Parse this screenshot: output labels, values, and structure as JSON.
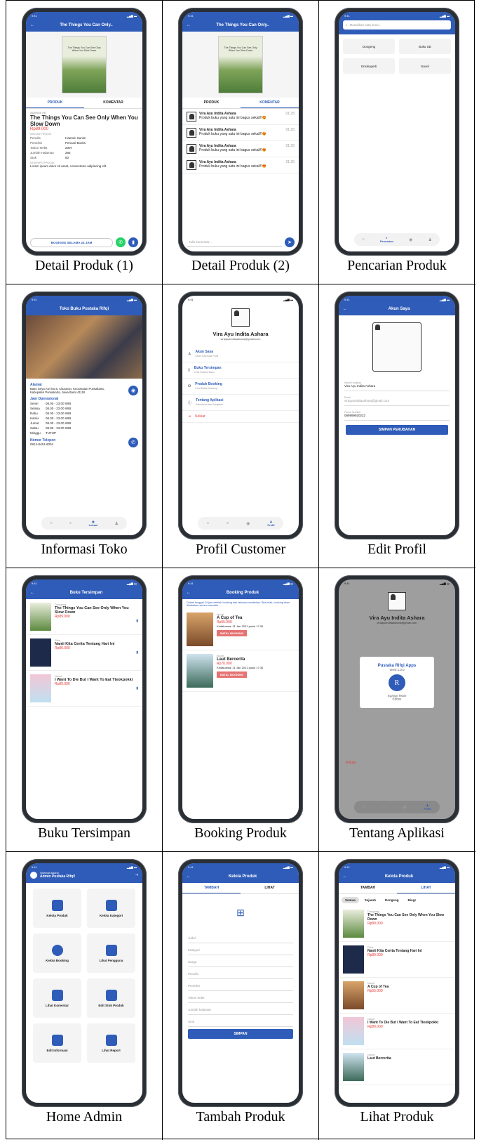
{
  "captions": [
    "Detail Produk (1)",
    "Detail Produk (2)",
    "Pencarian Produk",
    "Informasi Toko",
    "Profil Customer",
    "Edit Profil",
    "Buku Tersimpan",
    "Booking Produk",
    "Tentang Aplikasi",
    "Home Admin",
    "Tambah Produk",
    "Lihat Produk"
  ],
  "status_time": "9:41",
  "colors": {
    "primary": "#2f5cb8",
    "danger": "#e53935",
    "whatsapp": "#25d366"
  },
  "book_title_short": "The Things You Can Only..",
  "tabs": {
    "produk": "PRODUK",
    "komentar": "KOMENTAR",
    "tambah": "TAMBAH",
    "lihat": "LIHAT"
  },
  "detail": {
    "category": "Science Art",
    "title": "The Things You Can See Only When You Slow Down",
    "price": "Rp89.000",
    "info_head": "RINCIAN PRODUK",
    "rows": [
      {
        "k": "Penulis",
        "v": "Haemin Sunim"
      },
      {
        "k": "Penerbit",
        "v": "Pencari Books"
      },
      {
        "k": "Tahun Terbit",
        "v": "2007"
      },
      {
        "k": "Jumlah Halaman",
        "v": "265"
      },
      {
        "k": "Stok",
        "v": "50"
      }
    ],
    "desc_head": "DESKRIPSI PRODUK",
    "desc": "Lorem ipsum dolor sit amet, consectetur adipiscing elit.",
    "book_btn": "BOOKING SELAMA 24 JAM"
  },
  "comments": {
    "name": "Vira Ayu Indita Ashara",
    "time": "01:25",
    "items": [
      "Produk buku yang satu ini bagus sekali!!😍",
      "Produk buku yang satu ini bagus sekali!!😍",
      "Produk buku yang satu ini bagus sekali!!😍",
      "Produk buku yang satu ini bagus sekali!!😍"
    ],
    "placeholder": "Tulis komentar..."
  },
  "search": {
    "placeholder": "Masukkan kata kunci..",
    "chips": [
      "Dongeng",
      "Buku SD",
      "Enskiopedi",
      "Novel"
    ],
    "nav_label": "Pencarian"
  },
  "toko": {
    "title": "Toko Buku Pustaka Rifqi",
    "alamat_h": "Alamat",
    "alamat": "Baso Griya Asri No.6, Cisaueun, Kecamatan Purwakarta, Kabupaten Purwakarta, Jawa Barat 41118",
    "jam_h": "Jam Operasional",
    "jam": [
      {
        "d": "Senin",
        "t": "08.00 - 23.00 WIB"
      },
      {
        "d": "Selasa",
        "t": "08.00 - 23.00 WIB"
      },
      {
        "d": "Rabu",
        "t": "08.00 - 23.00 WIB"
      },
      {
        "d": "Kamis",
        "t": "08.00 - 23.00 WIB"
      },
      {
        "d": "Jumat",
        "t": "08.00 - 23.00 WIB"
      },
      {
        "d": "Sabtu",
        "t": "08.00 - 23.00 WIB"
      },
      {
        "d": "Minggu",
        "t": "TUTUP"
      }
    ],
    "telp_h": "Nomor Telepon",
    "telp": "0812-8451-6004",
    "nav_label": "Lokasi"
  },
  "profil": {
    "name": "Vira Ayu Indita Ashara",
    "email": "viraayuinditaashara@gmail.com",
    "menu": [
      {
        "t": "Akun Saya",
        "s": "Ubah Informasi Profil"
      },
      {
        "t": "Buku Tersimpan",
        "s": "Lihat Koleksi Buku"
      },
      {
        "t": "Produk Booking",
        "s": "Lihat Daftar Booking"
      },
      {
        "t": "Tentang Aplikasi",
        "s": "Ketentuan dan Kebijakan"
      }
    ],
    "logout": "Keluar",
    "nav_label": "Profil"
  },
  "edit": {
    "title": "Akun Saya",
    "f1l": "Nama Lengkap",
    "f1v": "Vira Ayu Indita Ashara",
    "f2l": "Email",
    "f2v": "viraayuinditaashara@gmail.com",
    "f3l": "Phone Number",
    "f3v": "089999920222",
    "btn": "SIMPAN PERUBAHAN"
  },
  "saved": {
    "title": "Buku Tersimpan",
    "items": [
      {
        "c": "Dongeng",
        "t": "The Things You Can See Only When You Slow Down",
        "p": "Rp89.000"
      },
      {
        "c": "Fiksi",
        "t": "Nanti Kita Cerita Tentang Hari Ini",
        "p": "Rp80.000"
      },
      {
        "c": "Novel",
        "t": "I Want To Die But I Want To Eat Tteokpokki",
        "p": "Rp89.000"
      }
    ]
  },
  "booking": {
    "title": "Booking Produk",
    "note": "Dalam tenggat 24 jam setelah booking dan lakukan pembelian. Bila tidak, booking akan dibatalkan secara otomatis.",
    "items": [
      {
        "c": "Novel",
        "t": "A Cup of Tea",
        "p": "Rp55.000",
        "d": "Kedaluarsa: 21 Jan 2021 pukul 17:30"
      },
      {
        "c": "Novel",
        "t": "Laut Bercerita",
        "p": "Rp70.000",
        "d": "Kedaluarsa: 21 Jan 2021 pukul 17:30"
      }
    ],
    "cancel": "BATAL BOOKING"
  },
  "about": {
    "app": "Pustaka Rifqi Apps",
    "ver": "Versi 1.0.0",
    "team": "Syzygy Team",
    "year": "©2021"
  },
  "admin": {
    "greet": "Selamat datang,",
    "name": "Admin Pustaka Rifqi!",
    "cards": [
      "Kelola Produk",
      "Kelola Kategori",
      "Kelola Booking",
      "Lihat Pengguna",
      "Lihat Komentar",
      "Edit Stok Produk",
      "Edit Informasi",
      "Lihat Report"
    ]
  },
  "tambah": {
    "title": "Kelola Produk",
    "fields": [
      "Judul",
      "Kategori",
      "Harga",
      "Penulis",
      "Penerbit",
      "Tahun terbit",
      "Jumlah halaman",
      "Stok"
    ],
    "btn": "SIMPAN"
  },
  "lihat": {
    "title": "Kelola Produk",
    "filters": [
      "Semua",
      "Sejarah",
      "Dongeng",
      "Biogr"
    ],
    "items": [
      {
        "c": "Dongeng",
        "t": "The Things You Can See Only When You Slow Down",
        "p": "Rp89.000"
      },
      {
        "c": "Fiksi",
        "t": "Nanti Kita Cerita Tentang Hari Ini",
        "p": "Rp80.000"
      },
      {
        "c": "Novel",
        "t": "A Cup of Tea",
        "p": "Rp55.000"
      },
      {
        "c": "Novel",
        "t": "I Want To Die But I Want To Eat Tteokpokki",
        "p": "Rp89.000"
      },
      {
        "c": "Novel",
        "t": "Laut Bercerita",
        "p": ""
      }
    ]
  }
}
